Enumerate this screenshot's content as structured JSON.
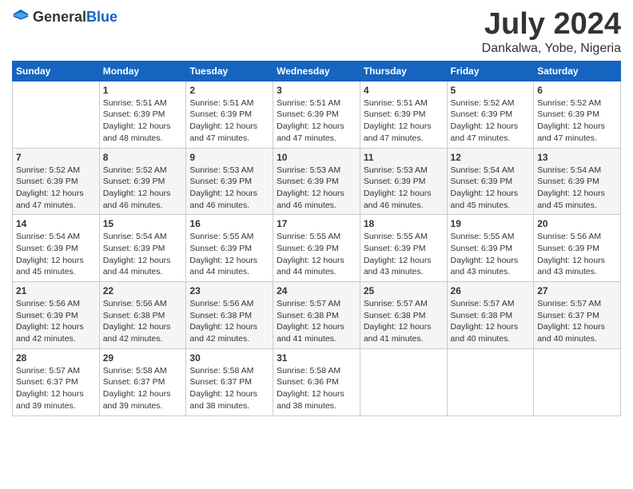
{
  "header": {
    "logo_general": "General",
    "logo_blue": "Blue",
    "main_title": "July 2024",
    "subtitle": "Dankalwa, Yobe, Nigeria"
  },
  "days_of_week": [
    "Sunday",
    "Monday",
    "Tuesday",
    "Wednesday",
    "Thursday",
    "Friday",
    "Saturday"
  ],
  "weeks": [
    [
      {
        "day": "",
        "text": ""
      },
      {
        "day": "1",
        "text": "Sunrise: 5:51 AM\nSunset: 6:39 PM\nDaylight: 12 hours\nand 48 minutes."
      },
      {
        "day": "2",
        "text": "Sunrise: 5:51 AM\nSunset: 6:39 PM\nDaylight: 12 hours\nand 47 minutes."
      },
      {
        "day": "3",
        "text": "Sunrise: 5:51 AM\nSunset: 6:39 PM\nDaylight: 12 hours\nand 47 minutes."
      },
      {
        "day": "4",
        "text": "Sunrise: 5:51 AM\nSunset: 6:39 PM\nDaylight: 12 hours\nand 47 minutes."
      },
      {
        "day": "5",
        "text": "Sunrise: 5:52 AM\nSunset: 6:39 PM\nDaylight: 12 hours\nand 47 minutes."
      },
      {
        "day": "6",
        "text": "Sunrise: 5:52 AM\nSunset: 6:39 PM\nDaylight: 12 hours\nand 47 minutes."
      }
    ],
    [
      {
        "day": "7",
        "text": "Sunrise: 5:52 AM\nSunset: 6:39 PM\nDaylight: 12 hours\nand 47 minutes."
      },
      {
        "day": "8",
        "text": "Sunrise: 5:52 AM\nSunset: 6:39 PM\nDaylight: 12 hours\nand 46 minutes."
      },
      {
        "day": "9",
        "text": "Sunrise: 5:53 AM\nSunset: 6:39 PM\nDaylight: 12 hours\nand 46 minutes."
      },
      {
        "day": "10",
        "text": "Sunrise: 5:53 AM\nSunset: 6:39 PM\nDaylight: 12 hours\nand 46 minutes."
      },
      {
        "day": "11",
        "text": "Sunrise: 5:53 AM\nSunset: 6:39 PM\nDaylight: 12 hours\nand 46 minutes."
      },
      {
        "day": "12",
        "text": "Sunrise: 5:54 AM\nSunset: 6:39 PM\nDaylight: 12 hours\nand 45 minutes."
      },
      {
        "day": "13",
        "text": "Sunrise: 5:54 AM\nSunset: 6:39 PM\nDaylight: 12 hours\nand 45 minutes."
      }
    ],
    [
      {
        "day": "14",
        "text": "Sunrise: 5:54 AM\nSunset: 6:39 PM\nDaylight: 12 hours\nand 45 minutes."
      },
      {
        "day": "15",
        "text": "Sunrise: 5:54 AM\nSunset: 6:39 PM\nDaylight: 12 hours\nand 44 minutes."
      },
      {
        "day": "16",
        "text": "Sunrise: 5:55 AM\nSunset: 6:39 PM\nDaylight: 12 hours\nand 44 minutes."
      },
      {
        "day": "17",
        "text": "Sunrise: 5:55 AM\nSunset: 6:39 PM\nDaylight: 12 hours\nand 44 minutes."
      },
      {
        "day": "18",
        "text": "Sunrise: 5:55 AM\nSunset: 6:39 PM\nDaylight: 12 hours\nand 43 minutes."
      },
      {
        "day": "19",
        "text": "Sunrise: 5:55 AM\nSunset: 6:39 PM\nDaylight: 12 hours\nand 43 minutes."
      },
      {
        "day": "20",
        "text": "Sunrise: 5:56 AM\nSunset: 6:39 PM\nDaylight: 12 hours\nand 43 minutes."
      }
    ],
    [
      {
        "day": "21",
        "text": "Sunrise: 5:56 AM\nSunset: 6:39 PM\nDaylight: 12 hours\nand 42 minutes."
      },
      {
        "day": "22",
        "text": "Sunrise: 5:56 AM\nSunset: 6:38 PM\nDaylight: 12 hours\nand 42 minutes."
      },
      {
        "day": "23",
        "text": "Sunrise: 5:56 AM\nSunset: 6:38 PM\nDaylight: 12 hours\nand 42 minutes."
      },
      {
        "day": "24",
        "text": "Sunrise: 5:57 AM\nSunset: 6:38 PM\nDaylight: 12 hours\nand 41 minutes."
      },
      {
        "day": "25",
        "text": "Sunrise: 5:57 AM\nSunset: 6:38 PM\nDaylight: 12 hours\nand 41 minutes."
      },
      {
        "day": "26",
        "text": "Sunrise: 5:57 AM\nSunset: 6:38 PM\nDaylight: 12 hours\nand 40 minutes."
      },
      {
        "day": "27",
        "text": "Sunrise: 5:57 AM\nSunset: 6:37 PM\nDaylight: 12 hours\nand 40 minutes."
      }
    ],
    [
      {
        "day": "28",
        "text": "Sunrise: 5:57 AM\nSunset: 6:37 PM\nDaylight: 12 hours\nand 39 minutes."
      },
      {
        "day": "29",
        "text": "Sunrise: 5:58 AM\nSunset: 6:37 PM\nDaylight: 12 hours\nand 39 minutes."
      },
      {
        "day": "30",
        "text": "Sunrise: 5:58 AM\nSunset: 6:37 PM\nDaylight: 12 hours\nand 38 minutes."
      },
      {
        "day": "31",
        "text": "Sunrise: 5:58 AM\nSunset: 6:36 PM\nDaylight: 12 hours\nand 38 minutes."
      },
      {
        "day": "",
        "text": ""
      },
      {
        "day": "",
        "text": ""
      },
      {
        "day": "",
        "text": ""
      }
    ]
  ]
}
